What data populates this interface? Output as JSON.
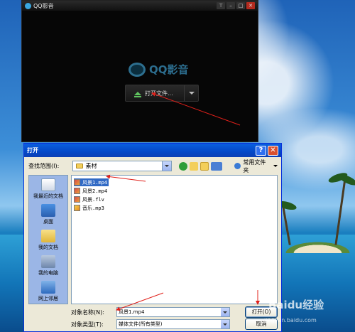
{
  "qq_player": {
    "title": "QQ影音",
    "brand_text": "QQ影音",
    "open_button_label": "打开文件..."
  },
  "dialog": {
    "title": "打开",
    "lookin_label": "查找范围(I):",
    "lookin_value": "素材",
    "favorites_label": "常用文件夹",
    "places": [
      {
        "label": "我最近的文档"
      },
      {
        "label": "桌面"
      },
      {
        "label": "我的文档"
      },
      {
        "label": "我的电脑"
      },
      {
        "label": "网上邻居"
      }
    ],
    "files": [
      {
        "name": "风景1.mp4",
        "type": "video",
        "selected": true
      },
      {
        "name": "风景2.mp4",
        "type": "video",
        "selected": false
      },
      {
        "name": "风景.flv",
        "type": "video",
        "selected": false
      },
      {
        "name": "音乐.mp3",
        "type": "audio",
        "selected": false
      }
    ],
    "filename_label": "对象名称(N):",
    "filename_value": "风景1.mp4",
    "filetype_label": "对象类型(T):",
    "filetype_value": "媒体文件(所有类型)",
    "open_button": "打开(O)",
    "cancel_button": "取消"
  },
  "watermark": {
    "text": "Baidu经验",
    "sub": "jingyan.baidu.com"
  },
  "colors": {
    "annotation_arrow": "#e0201a",
    "xp_title_blue": "#0348c8",
    "selection_blue": "#316ac5"
  }
}
